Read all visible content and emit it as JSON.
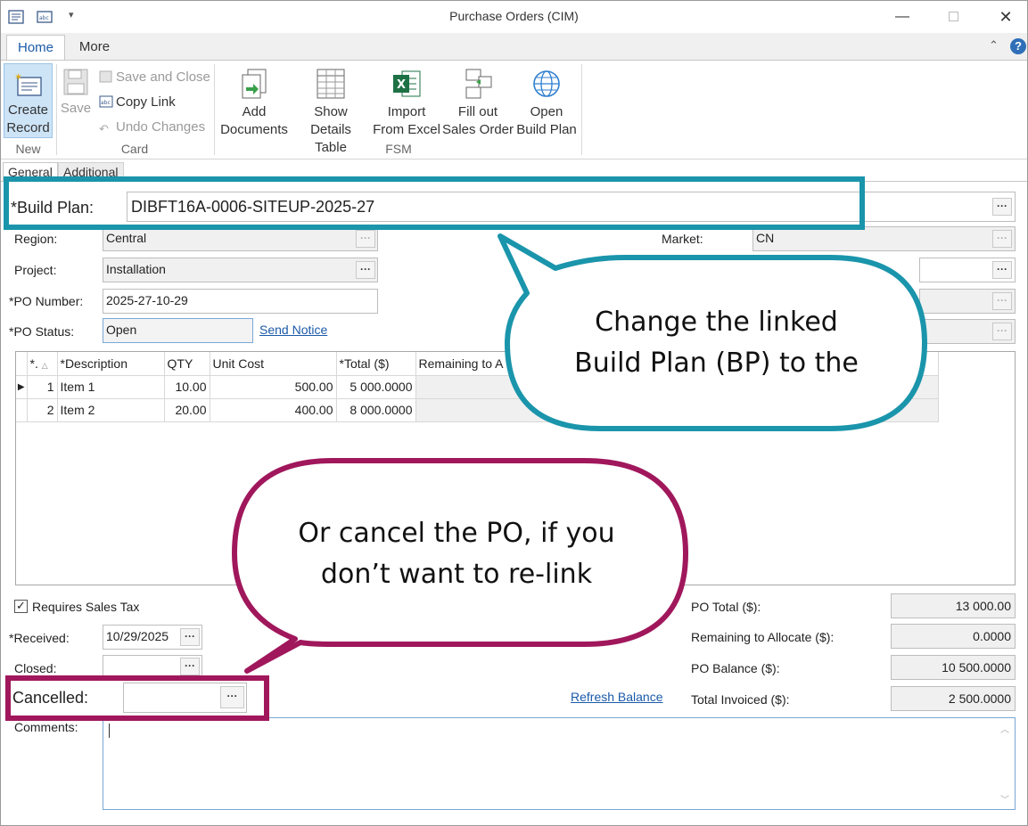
{
  "window": {
    "title": "Purchase Orders (CIM)"
  },
  "ribbon": {
    "tabs": [
      "Home",
      "More"
    ],
    "buttons": {
      "create_record": "Create\nRecord",
      "save": "Save",
      "save_and_close": "Save and Close",
      "copy_link": "Copy Link",
      "undo_changes": "Undo Changes",
      "add_documents": "Add\nDocuments",
      "show_details_table": "Show\nDetails Table",
      "import_from_excel": "Import\nFrom Excel",
      "fill_out_sales_order": "Fill out\nSales Order",
      "open_build_plan": "Open\nBuild Plan"
    },
    "groups": {
      "new": "New",
      "card": "Card",
      "fsm": "FSM"
    }
  },
  "form_tabs": [
    "General",
    "Additional"
  ],
  "form": {
    "build_plan_label": "*Build Plan:",
    "build_plan_value": "DIBFT16A-0006-SITEUP-2025-27",
    "region_label": "Region:",
    "region_value": "Central",
    "market_label": "Market:",
    "market_value": "CN",
    "project_label": "Project:",
    "project_value": "Installation",
    "po_number_label": "*PO Number:",
    "po_number_value": "2025-27-10-29",
    "po_status_label": "*PO Status:",
    "po_status_value": "Open",
    "send_notice": "Send Notice"
  },
  "grid": {
    "headers": [
      "*.",
      "*Description",
      "QTY",
      "Unit Cost",
      "*Total ($)",
      "Remaining to A"
    ],
    "rows": [
      {
        "num": "1",
        "description": "Item 1",
        "qty": "10.00",
        "unit_cost": "500.00",
        "total": "5 000.0000"
      },
      {
        "num": "2",
        "description": "Item 2",
        "qty": "20.00",
        "unit_cost": "400.00",
        "total": "8 000.0000"
      }
    ]
  },
  "bottom": {
    "requires_sales_tax": "Requires Sales Tax",
    "received_label": "*Received:",
    "received_value": "10/29/2025",
    "closed_label": "Closed:",
    "cancelled_label": "Cancelled:",
    "refresh_balance": "Refresh Balance",
    "comments_label": "Comments:",
    "po_total_label": "PO Total ($):",
    "po_total_value": "13 000.00",
    "remaining_label": "Remaining to Allocate ($):",
    "remaining_value": "0.0000",
    "po_balance_label": "PO Balance ($):",
    "po_balance_value": "10 500.0000",
    "total_invoiced_label": "Total Invoiced ($):",
    "total_invoiced_value": "2 500.0000"
  },
  "callouts": {
    "teal": "Change the linked\nBuild Plan (BP) to the",
    "magenta": "Or cancel the PO, if you\ndon’t want to re-link"
  },
  "colors": {
    "teal": "#1a95ab",
    "magenta": "#a0175c",
    "link": "#1b5aa8"
  }
}
